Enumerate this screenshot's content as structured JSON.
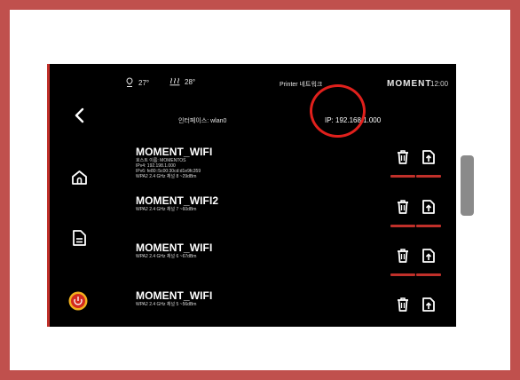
{
  "header": {
    "temp1": "27°",
    "temp2": "28°",
    "title": "Printer 네트워크",
    "brand": "moment",
    "time": "12:00"
  },
  "interface_label": "인터페이스: wlan0",
  "ip_label": "IP: 192.168.1.000",
  "networks": [
    {
      "name": "MOMENT_WIFI",
      "details": [
        "호스트 이름: MOMENTOS",
        "IPv4: 192.198.1.000",
        "IPv6: fe80::5c00:30cd:d1e9fc359",
        "WPA2 2.4 GHz 채널 8 ~29dBm"
      ]
    },
    {
      "name": "MOMENT_WIFI2",
      "details": [
        "WPA2 2.4 GHz 채널 7 ~60dBm"
      ]
    },
    {
      "name": "MOMENT_WIFI",
      "details": [
        "WPA2 2.4 GHz 채널 6 ~67dBm"
      ]
    },
    {
      "name": "MOMENT_WIFI",
      "details": [
        "WPA2 2.4 GHz 채널 5 ~56dBm"
      ]
    }
  ],
  "icons": {
    "back": "back-arrow-icon",
    "home": "home-icon",
    "files": "document-icon",
    "emergency": "emergency-stop-icon",
    "delete": "trash-icon",
    "connect": "file-upload-icon",
    "extruder": "extruder-temp-icon",
    "bed": "bed-temp-icon"
  },
  "colors": {
    "frame": "#c0504d",
    "accent": "#c0302a",
    "highlight_circle": "#e0201c",
    "screen": "#000000"
  }
}
